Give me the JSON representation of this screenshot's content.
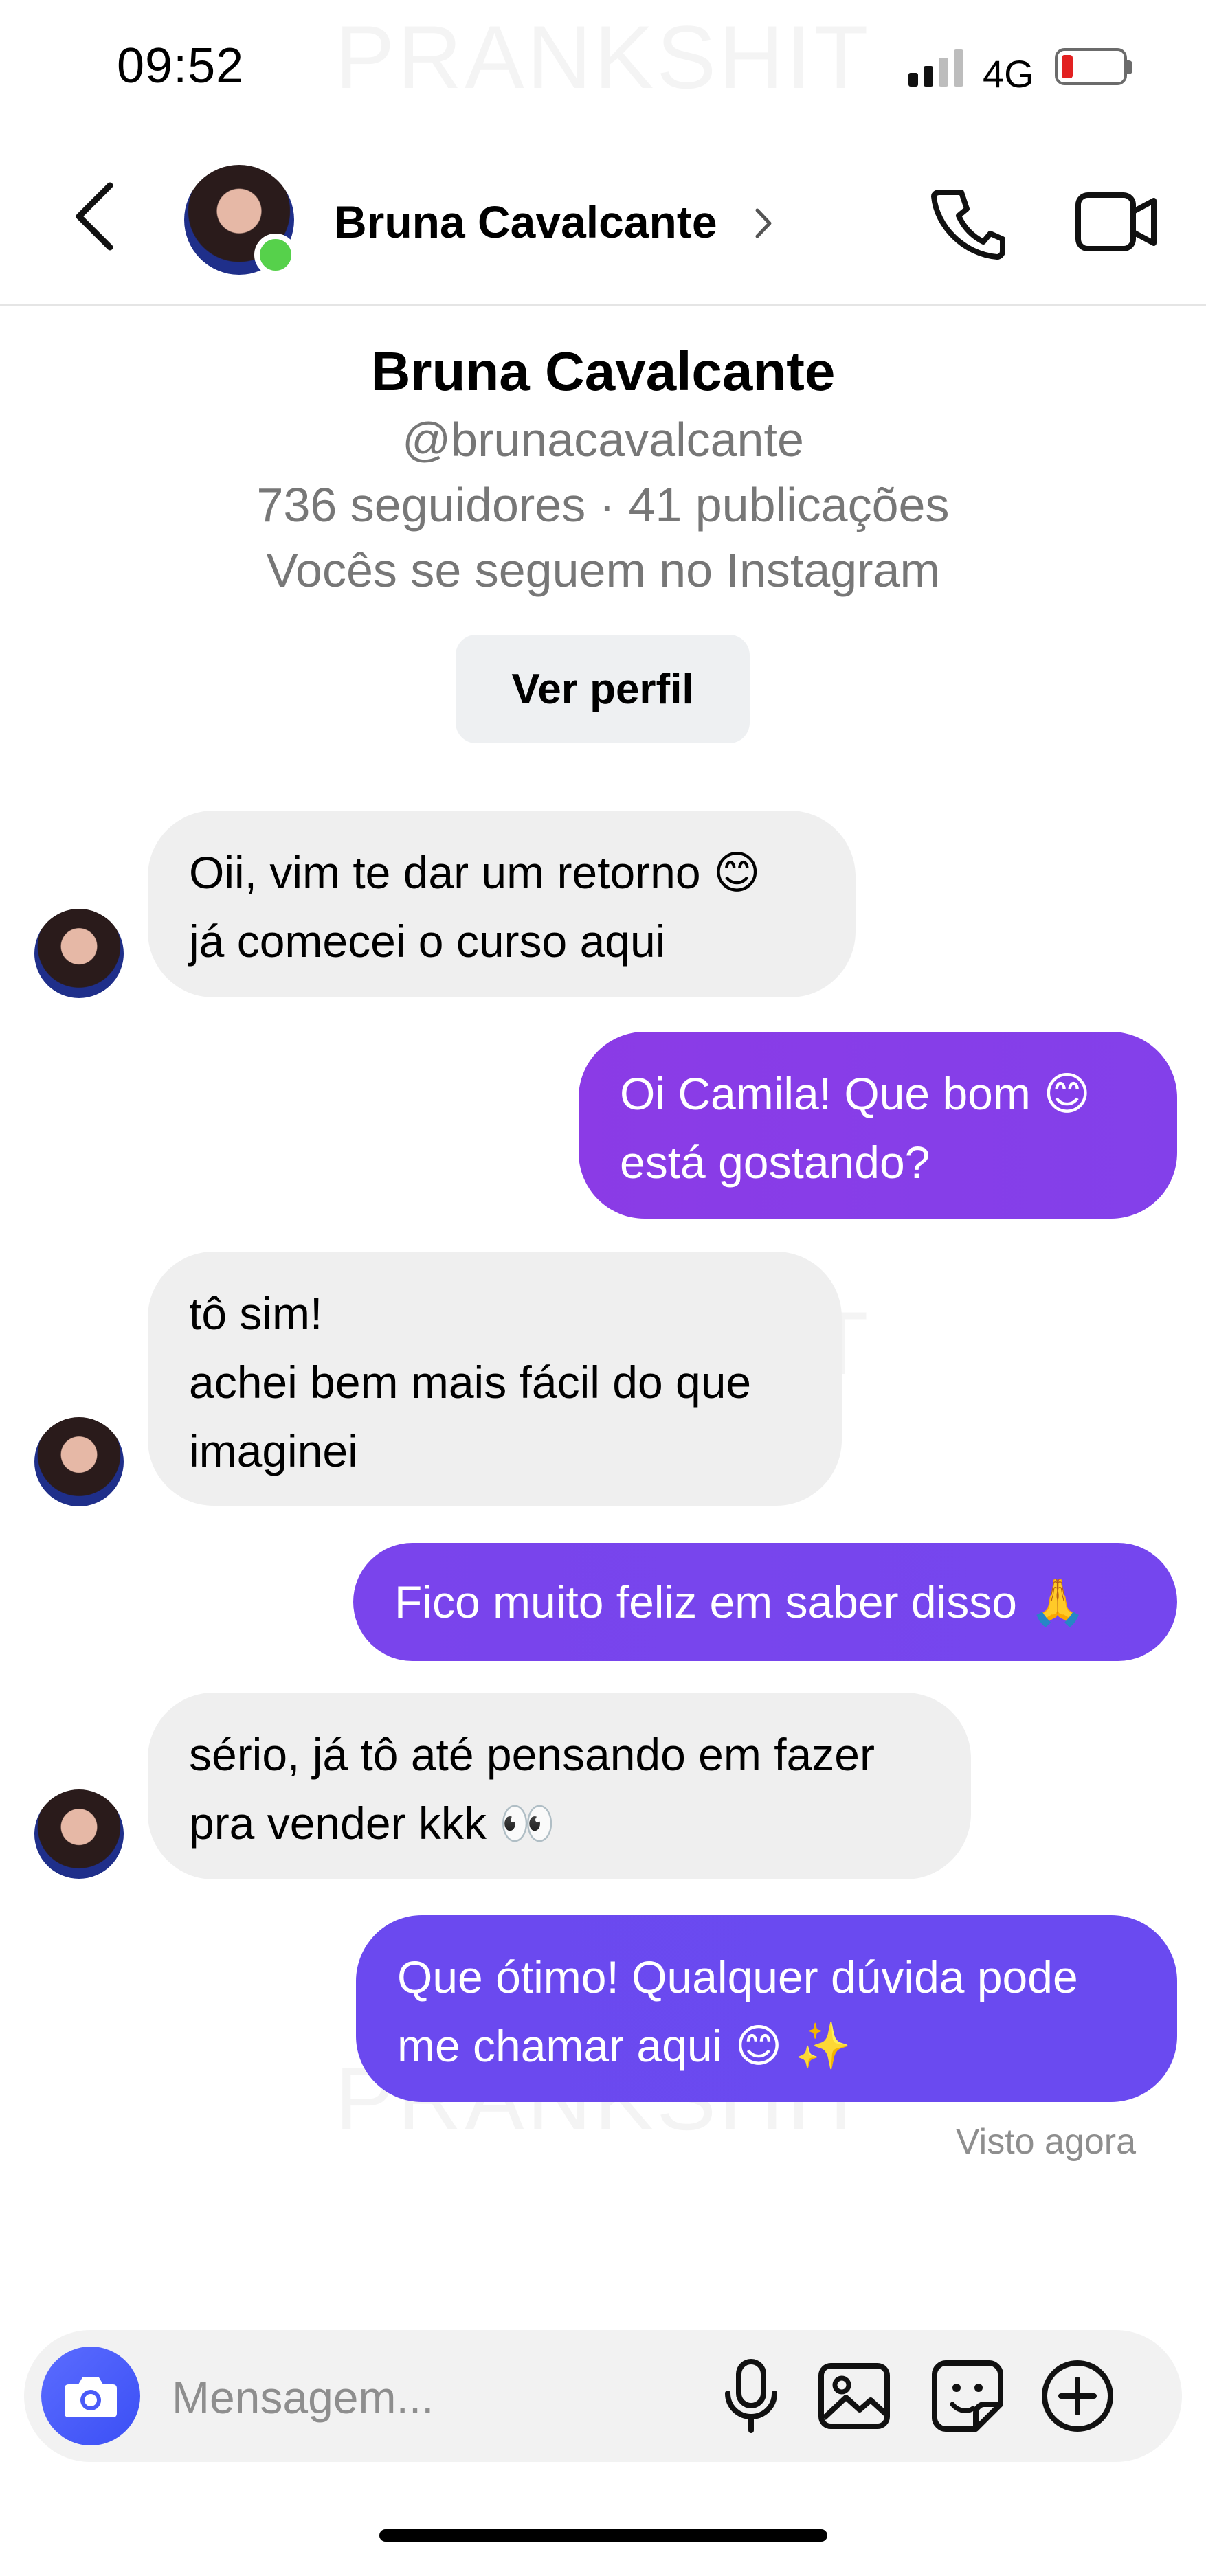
{
  "status_bar": {
    "time": "09:52",
    "network": "4G"
  },
  "watermark": "PRANKSHIT",
  "header": {
    "contact_name": "Bruna Cavalcante"
  },
  "profile": {
    "name": "Bruna Cavalcante",
    "handle": "@brunacavalcante",
    "stats": "736 seguidores · 41 publicações",
    "follow_status": "Vocês se seguem no Instagram",
    "view_profile_label": "Ver perfil"
  },
  "messages": [
    {
      "from": "them",
      "text": "Oii, vim te dar um retorno 😊\njá comecei o curso aqui"
    },
    {
      "from": "me",
      "text": "Oi Camila! Que bom 😊\nestá gostando?"
    },
    {
      "from": "them",
      "text": "tô sim!\nachei bem mais fácil do que\nimaginei"
    },
    {
      "from": "me",
      "text": "Fico muito feliz em saber disso 🙏"
    },
    {
      "from": "them",
      "text": "sério, já tô até pensando em fazer\npra vender kkk 👀"
    },
    {
      "from": "me",
      "text": "Que ótimo! Qualquer dúvida pode\nme chamar aqui 😊 ✨"
    }
  ],
  "seen_status": "Visto agora",
  "composer": {
    "placeholder": "Mensagem..."
  },
  "colors": {
    "outgoing_bubble_start": "#8b3be6",
    "outgoing_bubble_end": "#6a4af0",
    "incoming_bubble": "#efefef",
    "camera_button": "#4a5bf8",
    "online": "#56d14b"
  },
  "icons": [
    "back-chevron-icon",
    "phone-icon",
    "video-camera-icon",
    "camera-icon",
    "microphone-icon",
    "image-icon",
    "sticker-icon",
    "plus-circle-icon"
  ]
}
